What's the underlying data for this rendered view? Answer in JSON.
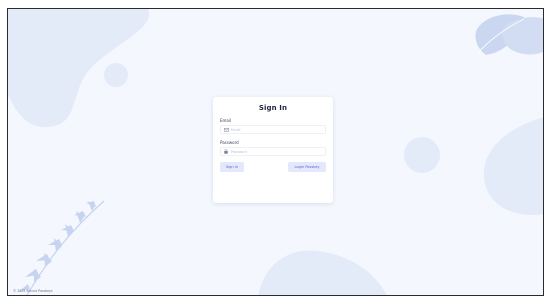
{
  "card": {
    "title": "Sign In",
    "email": {
      "label": "Email",
      "placeholder": "Email",
      "icon": "envelope-icon"
    },
    "password": {
      "label": "Password",
      "placeholder": "Password",
      "icon": "lock-icon"
    },
    "signin_button": "Sign In",
    "login_passkey_button": "Login Passkey"
  },
  "footer": {
    "text": "© 2025 Secure Passkeys"
  },
  "colors": {
    "background": "#f4f7fd",
    "blob": "#e3eaf8",
    "leaf": "#c7d4ef",
    "accent": "#5a63d8",
    "button_bg": "#e5e8fb"
  }
}
